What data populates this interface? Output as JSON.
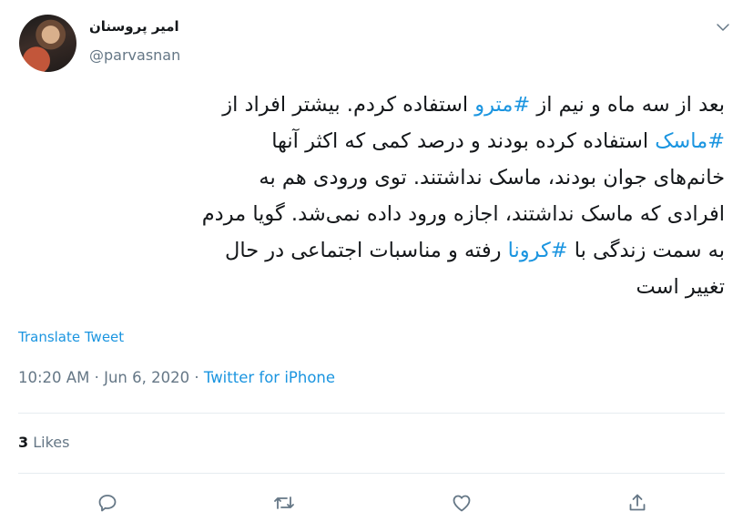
{
  "author": {
    "display_name": "امیر پروسنان",
    "handle": "@parvasnan"
  },
  "tweet": {
    "lines": [
      [
        {
          "t": "بعد از سه ماه و نیم از "
        },
        {
          "t": "#مترو",
          "tag": true
        },
        {
          "t": " استفاده کردم. بیشتر افراد از"
        }
      ],
      [
        {
          "t": "#ماسک",
          "tag": true
        },
        {
          "t": " استفاده کرده بودند و درصد کمی که اکثر آنها"
        }
      ],
      [
        {
          "t": "خانم‌های جوان بودند، ماسک نداشتند. توی ورودی هم به"
        }
      ],
      [
        {
          "t": "افرادی که ماسک نداشتند، اجازه ورود داده نمی‌شد. گویا مردم"
        }
      ],
      [
        {
          "t": "به سمت زندگی با "
        },
        {
          "t": "#کرونا",
          "tag": true
        },
        {
          "t": " رفته و مناسبات اجتماعی در حال"
        }
      ],
      [
        {
          "t": "تغییر است"
        }
      ]
    ]
  },
  "translate_label": "Translate Tweet",
  "meta": {
    "time": "10:20 AM",
    "separator": " · ",
    "date": "Jun 6, 2020",
    "source": "Twitter for iPhone"
  },
  "likes": {
    "count": "3",
    "label": "Likes"
  },
  "colors": {
    "link": "#1b95e0",
    "secondary_text": "#657786",
    "divider": "#e6ecf0"
  },
  "icons": {
    "more": "chevron-down-icon",
    "reply": "reply-icon",
    "retweet": "retweet-icon",
    "like": "heart-icon",
    "share": "share-icon"
  }
}
